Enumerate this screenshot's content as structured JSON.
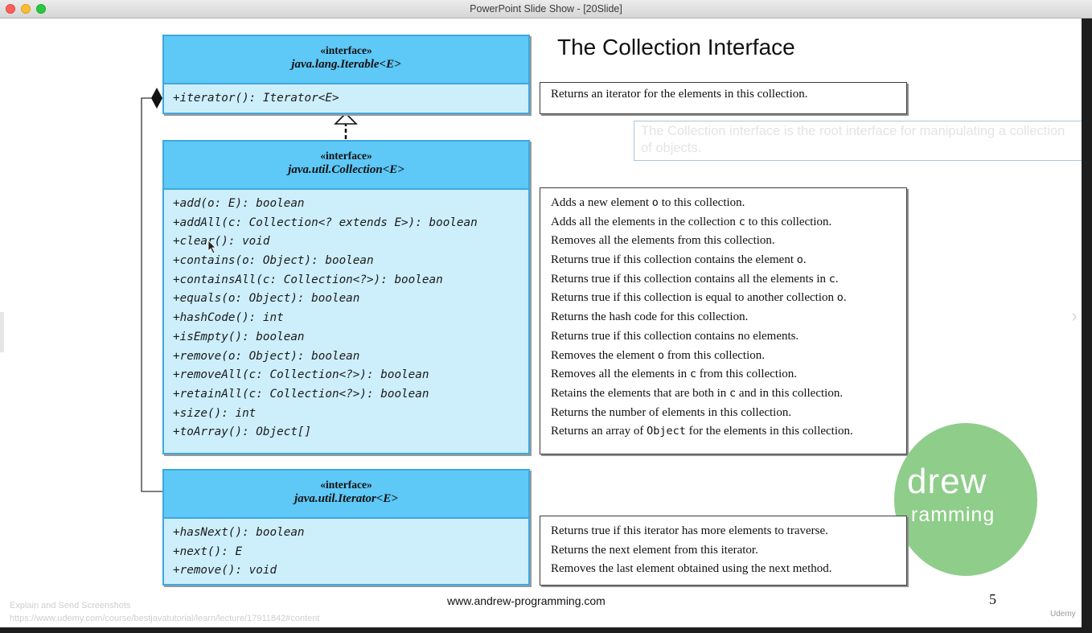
{
  "window": {
    "title": "PowerPoint Slide Show - [20Slide]"
  },
  "slide": {
    "title": "The Collection Interface",
    "note": "The Collection interface is the root interface for manipulating a collection of objects.",
    "footer_url": "www.andrew-programming.com",
    "page_number": "5",
    "logo": {
      "line1": "drew",
      "line2": "ramming"
    },
    "iterable": {
      "stereotype": "«interface»",
      "name": "java.lang.Iterable<E>",
      "methods": [
        "+iterator(): Iterator<E>"
      ],
      "descriptions": [
        "Returns an iterator for the elements in this collection."
      ]
    },
    "collection": {
      "stereotype": "«interface»",
      "name": "java.util.Collection<E>",
      "methods": [
        "+add(o: E): boolean",
        "+addAll(c: Collection<? extends E>): boolean",
        "+clear(): void",
        "+contains(o: Object): boolean",
        "+containsAll(c: Collection<?>): boolean",
        "+equals(o: Object): boolean",
        "+hashCode(): int",
        "+isEmpty(): boolean",
        "+remove(o: Object): boolean",
        "+removeAll(c: Collection<?>): boolean",
        "+retainAll(c: Collection<?>): boolean",
        "+size(): int",
        "+toArray(): Object[]"
      ],
      "descriptions": [
        "Adds a new element o to this collection.",
        "Adds all the elements in the collection c to this collection.",
        "Removes all the elements from this collection.",
        "Returns true if this collection contains the element o.",
        "Returns true if this collection contains all the elements in c.",
        "Returns true if this collection is equal to another collection o.",
        "Returns the hash code for this collection.",
        "Returns true if this collection contains no elements.",
        "Removes the element o from this collection.",
        "Removes all the elements in c from this collection.",
        "Retains the elements that are both in c and in this collection.",
        "Returns the number of elements in this collection.",
        "Returns an array of Object for the elements in this collection."
      ]
    },
    "iterator": {
      "stereotype": "«interface»",
      "name": "java.util.Iterator<E>",
      "methods": [
        "+hasNext(): boolean",
        "+next(): E",
        "+remove(): void"
      ],
      "descriptions": [
        "Returns true if this iterator has more elements to traverse.",
        "Returns the next element from this iterator.",
        "Removes the last element obtained using the next method."
      ]
    }
  },
  "overlay": {
    "line1": "Explain and Send Screenshots",
    "line2": "https://www.udemy.com/course/bestjavatutorial/learn/lecture/17911842#content",
    "watermark": "Udemy"
  }
}
